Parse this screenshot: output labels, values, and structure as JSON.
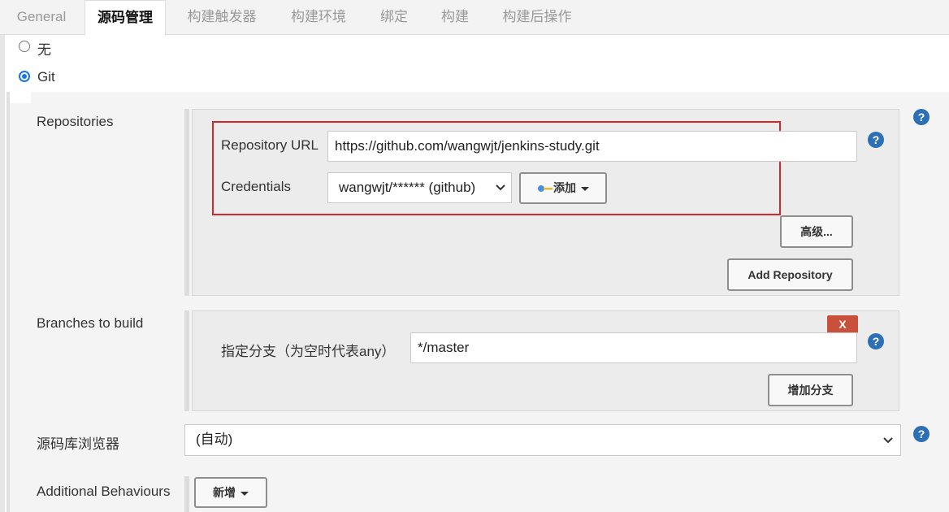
{
  "tabs": [
    {
      "label": "General"
    },
    {
      "label": "源码管理"
    },
    {
      "label": "构建触发器"
    },
    {
      "label": "构建环境"
    },
    {
      "label": "绑定"
    },
    {
      "label": "构建"
    },
    {
      "label": "构建后操作"
    }
  ],
  "scm": {
    "option_none": "无",
    "option_git": "Git",
    "selected": "Git"
  },
  "repositories": {
    "label": "Repositories",
    "url_label": "Repository URL",
    "url_value": "https://github.com/wangwjt/jenkins-study.git",
    "credentials_label": "Credentials",
    "credentials_value": "wangwjt/****** (github)",
    "add_button": "添加",
    "advanced_button": "高级...",
    "add_repository_button": "Add Repository"
  },
  "branches": {
    "label": "Branches to build",
    "delete_button": "X",
    "branch_label": "指定分支（为空时代表any）",
    "branch_value": "*/master",
    "add_branch_button": "增加分支"
  },
  "browser": {
    "label": "源码库浏览器",
    "value": "(自动)"
  },
  "behaviours": {
    "label": "Additional Behaviours",
    "add_button": "新增"
  },
  "colors": {
    "highlight_box": "#d9262c",
    "help_icon": "#2d6fb5",
    "delete_button": "#c9513b",
    "radio_checked": "#1a73e8"
  }
}
